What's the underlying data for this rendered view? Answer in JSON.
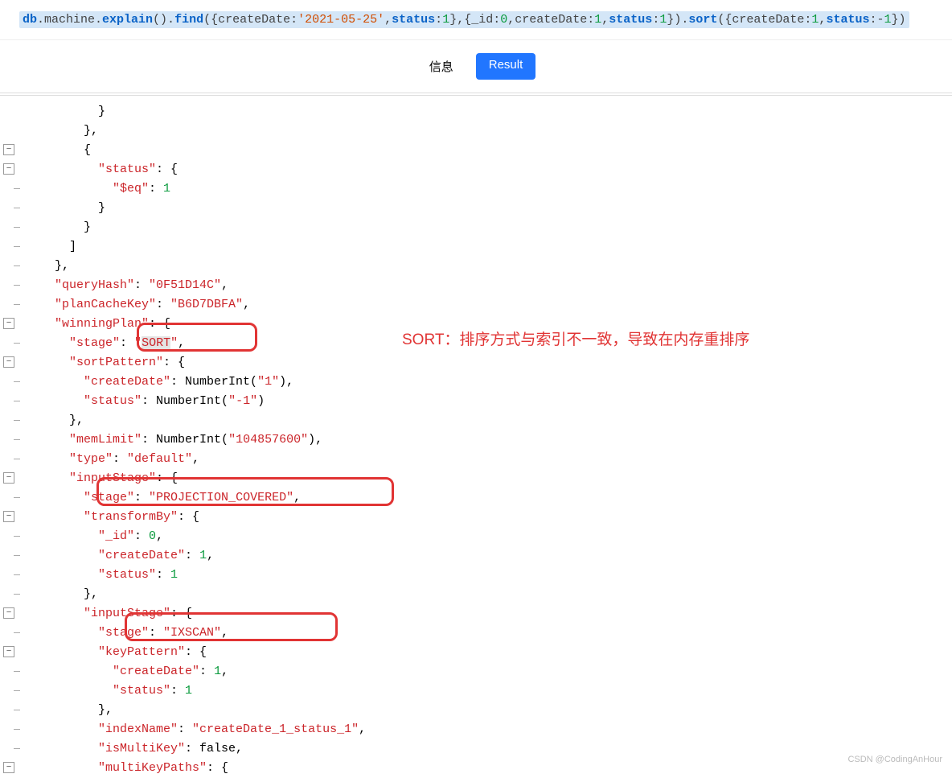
{
  "query": {
    "p1_db": "db",
    "p2_dot1": ".machine.",
    "p3_explain": "explain",
    "p4_paren": "().",
    "p5_find": "find",
    "p6_open": "({createDate:",
    "p7_date": "'2021-05-25'",
    "p8_c1": ",",
    "p9_status": "status",
    "p10_c2": ":",
    "p11_n1": "1",
    "p12_close1": "},{_id:",
    "p13_n0": "0",
    "p14_c3": ",createDate:",
    "p15_n1b": "1",
    "p16_c4": ",",
    "p17_status2": "status",
    "p18_c5": ":",
    "p19_n1c": "1",
    "p20_close2": "}).",
    "p21_sort": "sort",
    "p22_open2": "({createDate:",
    "p23_n1d": "1",
    "p24_c6": ",",
    "p25_status3": "status",
    "p26_c7": ":-",
    "p27_n1e": "1",
    "p28_close3": "})"
  },
  "tabs": {
    "info": "信息",
    "result": "Result"
  },
  "annotation": "SORT：排序方式与索引不一致，导致在内存重排序",
  "watermark": "CSDN @CodingAnHour",
  "code": {
    "l0": "          }",
    "l1": "        },",
    "l2": "        {",
    "l3a": "          \"status\"",
    "l3b": ": {",
    "l4a": "            \"$eq\"",
    "l4b": ": ",
    "l4c": "1",
    "l5": "          }",
    "l6": "        }",
    "l7": "      ]",
    "l8": "    },",
    "l9a": "    \"queryHash\"",
    "l9b": ": ",
    "l9c": "\"0F51D14C\"",
    "l9d": ",",
    "l10a": "    \"planCacheKey\"",
    "l10b": ": ",
    "l10c": "\"B6D7DBFA\"",
    "l10d": ",",
    "l11a": "    \"winningPlan\"",
    "l11b": ": {",
    "l12a": "      \"stage\"",
    "l12b": ": ",
    "l12c": "\"SORT\"",
    "l12d": ",",
    "l13a": "      \"sortPattern\"",
    "l13b": ": {",
    "l14a": "        \"createDate\"",
    "l14b": ": NumberInt(",
    "l14c": "\"1\"",
    "l14d": "),",
    "l15a": "        \"status\"",
    "l15b": ": NumberInt(",
    "l15c": "\"-1\"",
    "l15d": ")",
    "l16": "      },",
    "l17a": "      \"memLimit\"",
    "l17b": ": NumberInt(",
    "l17c": "\"104857600\"",
    "l17d": "),",
    "l18a": "      \"type\"",
    "l18b": ": ",
    "l18c": "\"default\"",
    "l18d": ",",
    "l19a": "      \"inputStage\"",
    "l19b": ": {",
    "l20a": "        \"stage\"",
    "l20b": ": ",
    "l20c": "\"PROJECTION_COVERED\"",
    "l20d": ",",
    "l21a": "        \"transformBy\"",
    "l21b": ": {",
    "l22a": "          \"_id\"",
    "l22b": ": ",
    "l22c": "0",
    "l22d": ",",
    "l23a": "          \"createDate\"",
    "l23b": ": ",
    "l23c": "1",
    "l23d": ",",
    "l24a": "          \"status\"",
    "l24b": ": ",
    "l24c": "1",
    "l25": "        },",
    "l26a": "        \"inputStage\"",
    "l26b": ": {",
    "l27a": "          \"stage\"",
    "l27b": ": ",
    "l27c": "\"IXSCAN\"",
    "l27d": ",",
    "l28a": "          \"keyPattern\"",
    "l28b": ": {",
    "l29a": "            \"createDate\"",
    "l29b": ": ",
    "l29c": "1",
    "l29d": ",",
    "l30a": "            \"status\"",
    "l30b": ": ",
    "l30c": "1",
    "l31": "          },",
    "l32a": "          \"indexName\"",
    "l32b": ": ",
    "l32c": "\"createDate_1_status_1\"",
    "l32d": ",",
    "l33a": "          \"isMultiKey\"",
    "l33b": ": false,",
    "l34a": "          \"multiKeyPaths\"",
    "l34b": ": {"
  }
}
